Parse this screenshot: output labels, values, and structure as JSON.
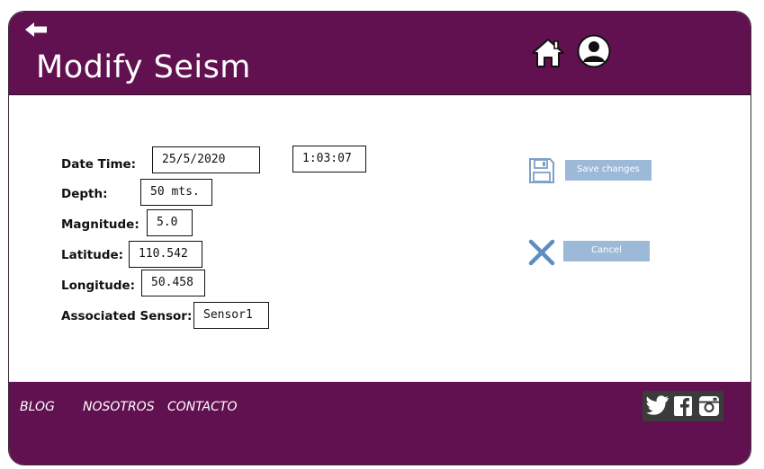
{
  "header": {
    "title": "Modify Seism",
    "back_icon": "arrow-left-icon",
    "home_icon": "home-icon",
    "user_icon": "user-avatar-icon"
  },
  "form": {
    "datetime_label": "Date Time:",
    "date_value": "25/5/2020",
    "time_value": "1:03:07",
    "depth_label": "Depth:",
    "depth_value": "50 mts.",
    "magnitude_label": "Magnitude:",
    "magnitude_value": "5.0",
    "latitude_label": "Latitude:",
    "latitude_value": "110.542",
    "longitude_label": "Longitude:",
    "longitude_value": "50.458",
    "sensor_label": "Associated Sensor:",
    "sensor_value": "Sensor1"
  },
  "actions": {
    "save_label": "Save changes",
    "cancel_label": "Cancel",
    "save_icon": "floppy-disk-icon",
    "cancel_icon": "x-icon"
  },
  "footer": {
    "links": [
      "BLOG",
      "NOSOTROS",
      "CONTACTO"
    ],
    "social": [
      "twitter-icon",
      "facebook-icon",
      "instagram-icon"
    ]
  },
  "colors": {
    "primary": "#621150",
    "button": "#9db9d8",
    "cancel_icon": "#5b8fc4"
  }
}
